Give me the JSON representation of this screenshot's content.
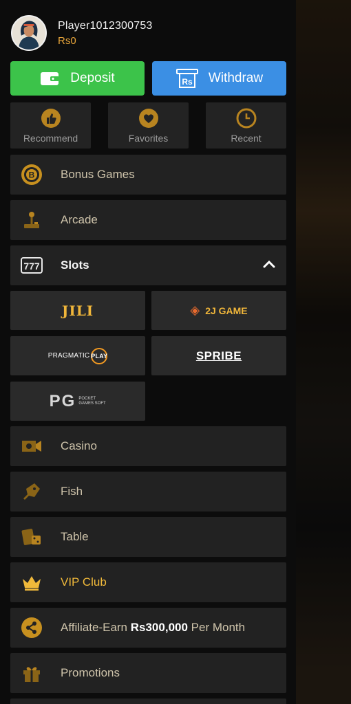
{
  "profile": {
    "username": "Player1012300753",
    "balance": "Rs0"
  },
  "actions": {
    "deposit_label": "Deposit",
    "withdraw_label": "Withdraw",
    "withdraw_icon_text": "Rs"
  },
  "quick_links": [
    {
      "label": "Recommend",
      "icon": "thumbs-up-icon"
    },
    {
      "label": "Favorites",
      "icon": "heart-icon"
    },
    {
      "label": "Recent",
      "icon": "clock-icon"
    }
  ],
  "menu": {
    "bonus_games": "Bonus Games",
    "arcade": "Arcade",
    "slots": "Slots",
    "casino": "Casino",
    "fish": "Fish",
    "table": "Table",
    "vip_club": "VIP Club",
    "affiliate": {
      "prefix": "Affiliate-Earn",
      "amount": "Rs300,000",
      "suffix": "Per Month"
    },
    "promotions": "Promotions"
  },
  "providers": {
    "jili": "JILI",
    "twoj": "2J GAME",
    "pragmatic_text": "PRAGMATIC",
    "pragmatic_play": "PLAY",
    "spribe": "SPRIBE",
    "pg_big": "PG",
    "pg_small": "POCKET GAMES SOFT"
  },
  "colors": {
    "accent_gold": "#f0b93a",
    "deposit_green": "#3cc34a",
    "withdraw_blue": "#3b8fe4",
    "panel": "#222222"
  }
}
